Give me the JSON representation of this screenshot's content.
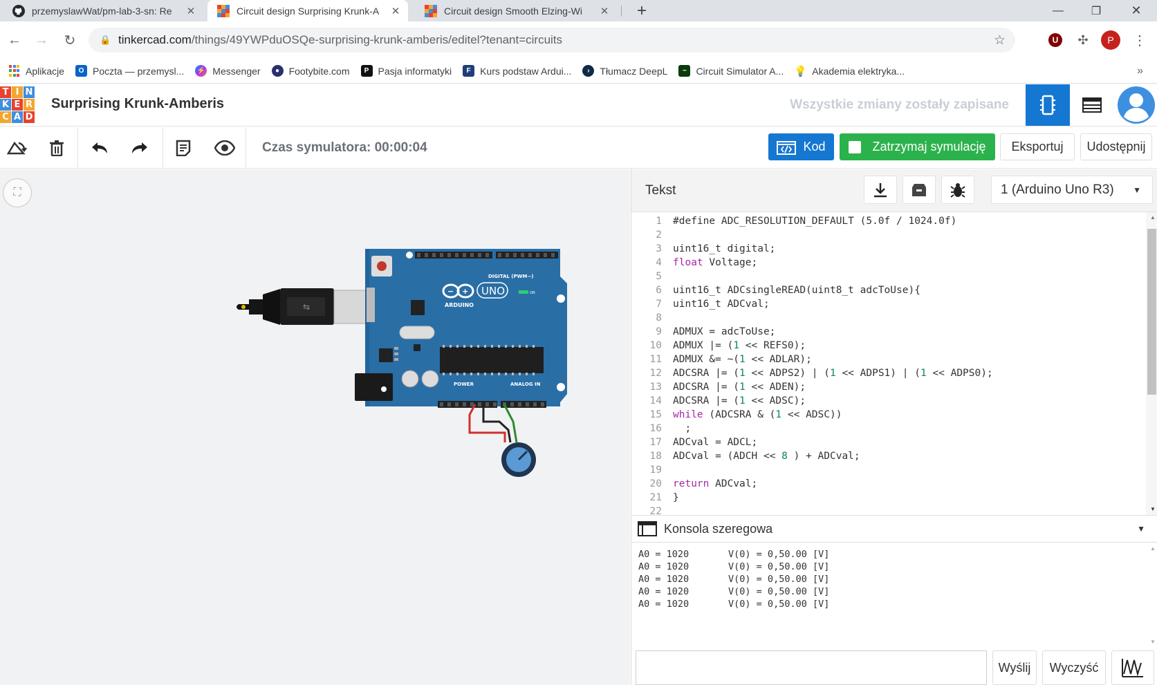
{
  "browser": {
    "tabs": [
      {
        "title": "przemyslawWat/pm-lab-3-sn: Re",
        "icon": "github-icon"
      },
      {
        "title": "Circuit design Surprising Krunk-A",
        "icon": "tinkercad-icon"
      },
      {
        "title": "Circuit design Smooth Elzing-Wi",
        "icon": "tinkercad-icon"
      }
    ],
    "url_host": "tinkercad.com",
    "url_path": "/things/49YWPduOSQe-surprising-krunk-amberis/editel?tenant=circuits",
    "profile_initial": "P",
    "ext_initial": "U",
    "bookmarks": [
      {
        "label": "Aplikacje",
        "icon": "apps-grid-icon"
      },
      {
        "label": "Poczta — przemysl...",
        "icon": "outlook-icon"
      },
      {
        "label": "Messenger",
        "icon": "messenger-icon"
      },
      {
        "label": "Footybite.com",
        "icon": "footybite-icon"
      },
      {
        "label": "Pasja informatyki",
        "icon": "pasja-icon"
      },
      {
        "label": "Kurs podstaw Ardui...",
        "icon": "forbot-icon"
      },
      {
        "label": "Tłumacz DeepL",
        "icon": "deepl-icon"
      },
      {
        "label": "Circuit Simulator A...",
        "icon": "circuit-sim-icon"
      },
      {
        "label": "Akademia elektryka...",
        "icon": "bulb-icon"
      }
    ]
  },
  "app": {
    "logo_letters": [
      "T",
      "I",
      "N",
      "K",
      "E",
      "R",
      "C",
      "A",
      "D"
    ],
    "project_name": "Surprising Krunk-Amberis",
    "save_status": "Wszystkie zmiany zostały zapisane",
    "sim_time": "Czas symulatora: 00:00:04",
    "buttons": {
      "code": "Kod",
      "stop_sim": "Zatrzymaj symulację",
      "export": "Eksportuj",
      "share": "Udostępnij"
    }
  },
  "board": {
    "name_text": "ARDUINO",
    "model_text": "UNO",
    "digital_label": "DIGITAL (PWM~)",
    "power_label": "POWER",
    "analog_label": "ANALOG IN",
    "on_label": "ON"
  },
  "code_panel": {
    "mode_label": "Tekst",
    "device_select": "1 (Arduino Uno R3)",
    "lines": [
      "#define ADC_RESOLUTION_DEFAULT (5.0f / 1024.0f)",
      "",
      "uint16_t digital;",
      "float Voltage;",
      "",
      "uint16_t ADCsingleREAD(uint8_t adcToUse){",
      "uint16_t ADCval;",
      "",
      "ADMUX = adcToUse;",
      "ADMUX |= (1 << REFS0);",
      "ADMUX &= ~(1 << ADLAR);",
      "ADCSRA |= (1 << ADPS2) | (1 << ADPS1) | (1 << ADPS0);",
      "ADCSRA |= (1 << ADEN);",
      "ADCSRA |= (1 << ADSC);",
      "while (ADCSRA & (1 << ADSC))",
      "  ;",
      "ADCval = ADCL;",
      "ADCval = (ADCH << 8 ) + ADCval;",
      "",
      "return ADCval;",
      "}",
      ""
    ],
    "serial_title": "Konsola szeregowa",
    "serial_lines": [
      "A0 = 1020       V(0) = 0,50.00 [V]",
      "A0 = 1020       V(0) = 0,50.00 [V]",
      "A0 = 1020       V(0) = 0,50.00 [V]",
      "A0 = 1020       V(0) = 0,50.00 [V]",
      "A0 = 1020       V(0) = 0,50.00 [V]"
    ],
    "send_label": "Wyślij",
    "clear_label": "Wyczyść"
  },
  "colors": {
    "accent_blue": "#1477d1",
    "green": "#2bb24c",
    "board_blue": "#2a6ea6"
  }
}
